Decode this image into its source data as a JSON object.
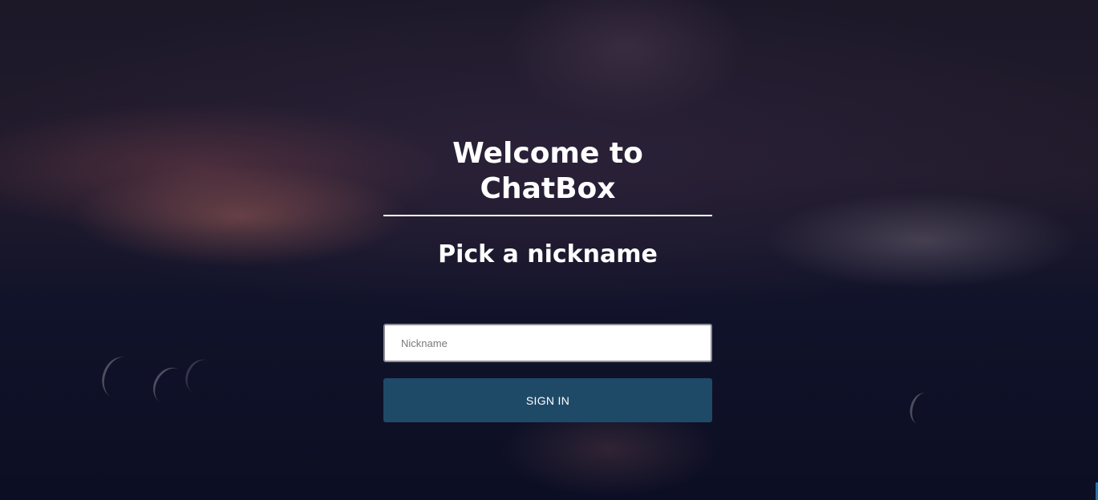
{
  "login": {
    "title": "Welcome to ChatBox",
    "subtitle": "Pick a nickname",
    "nickname_placeholder": "Nickname",
    "nickname_value": "",
    "sign_in_label": "SIGN IN"
  },
  "colors": {
    "button_background": "#1e4a68",
    "title_text": "#ffffff",
    "background_dark": "#0d0f22"
  }
}
